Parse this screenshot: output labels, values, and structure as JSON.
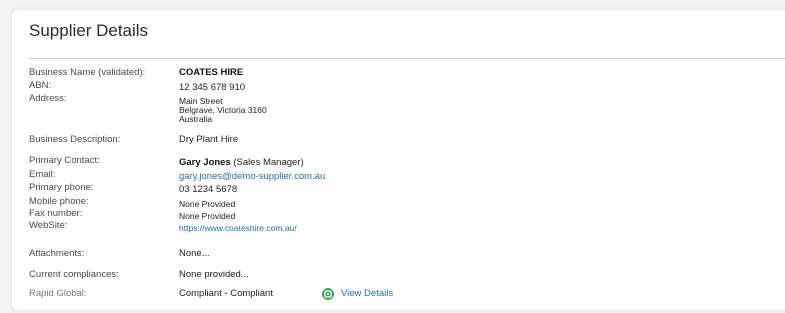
{
  "panel": {
    "title": "Supplier Details"
  },
  "fields": {
    "business_name_label": "Business Name (validated):",
    "business_name": "COATES HIRE",
    "abn_label": "ABN:",
    "abn": "12 345 678 910",
    "address_label": "Address:",
    "address_line1": "Main Street",
    "address_line2": "Belgrave, Victoria 3160",
    "address_line3": "Australia",
    "description_label": "Business Description:",
    "description": "Dry Plant Hire",
    "primary_contact_label": "Primary Contact:",
    "primary_contact_name": "Gary Jones",
    "primary_contact_role": "(Sales Manager)",
    "email_label": "Email:",
    "email": "gary.jones@demo-supplier.com.au",
    "primary_phone_label": "Primary phone:",
    "primary_phone": "03 1234 5678",
    "mobile_phone_label": "Mobile phone:",
    "mobile_phone": "None Provided",
    "fax_label": "Fax number:",
    "fax": "None Provided",
    "website_label": "WebSite:",
    "website": "https://www.coateshire.com.au/",
    "attachments_label": "Attachments:",
    "attachments": "None...",
    "compliances_label": "Current compliances:",
    "compliances": "None provided...",
    "rapid_global_label": "Rapid Global:",
    "rapid_global_status": "Compliant - Compliant",
    "rapid_global_icon": "compliant-badge-icon",
    "view_details_label": "View Details"
  },
  "colors": {
    "link": "#2a6bb0",
    "compliant": "#3ca65a",
    "divider": "#bcd3d8"
  }
}
